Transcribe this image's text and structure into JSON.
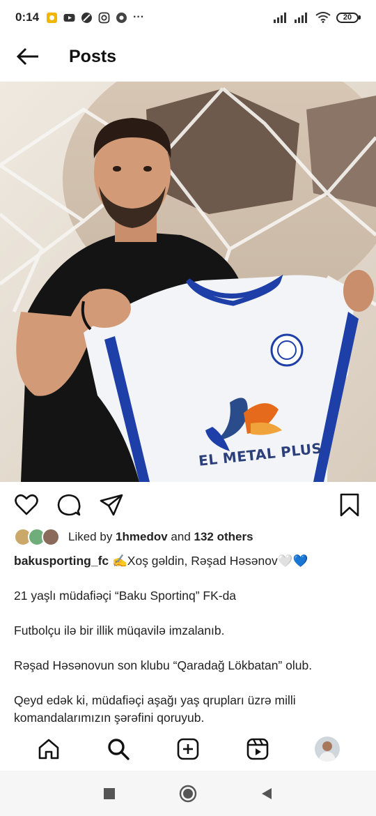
{
  "status_bar": {
    "time": "0:14",
    "battery": "20",
    "left_icons": [
      "notification-icon",
      "youtube-icon",
      "blocked-icon",
      "instagram-icon",
      "chrome-icon",
      "more-dots-icon"
    ],
    "more": "···"
  },
  "header": {
    "title": "Posts"
  },
  "post": {
    "image_text": {
      "sponsor": "EL METAL PLUS"
    },
    "likes": {
      "prefix": "Liked by ",
      "user": "1hmedov",
      "middle": " and ",
      "count": "132 others"
    },
    "caption": {
      "username": "bakusporting_fc",
      "first_line": " ✍️Xoş gəldin, Rəşad Həsənov🤍💙",
      "lines": [
        "21 yaşlı müdafiəçi “Baku Sportinq” FK-da",
        "Futbolçu ilə bir illik müqavilə imzalanıb.",
        "Rəşad Həsənovun son klubu “Qaradağ Lökbatan” olub.",
        "Qeyd edək ki, müdafiəçi aşağı yaş qrupları üzrə milli",
        "komandalarımızın şərəfini qoruyub."
      ]
    }
  },
  "bottom_nav": {
    "items": [
      "home-icon",
      "search-icon",
      "create-post-icon",
      "reels-icon",
      "profile-avatar"
    ]
  },
  "colors": {
    "text": "#111111",
    "jersey_blue": "#1f3fa8",
    "logo_orange": "#e56a1b"
  }
}
